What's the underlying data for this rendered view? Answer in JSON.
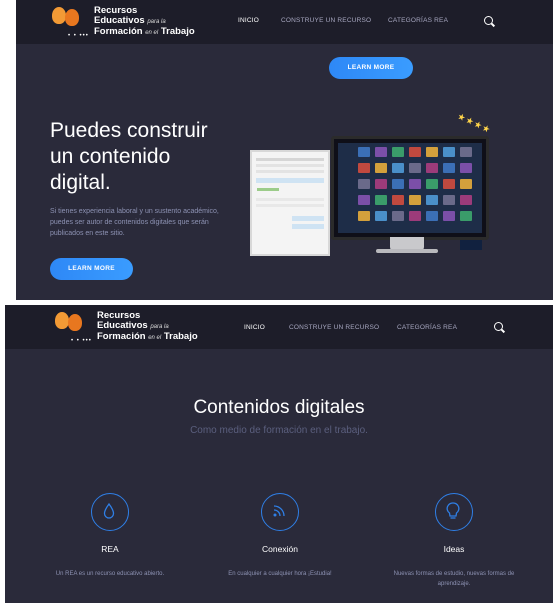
{
  "screens": [
    {
      "logo": {
        "line1": "Recursos",
        "line2": "Educativos",
        "line2_small": "para la",
        "line3": "Formación",
        "line3_small": "en el",
        "line4": "Trabajo",
        "dots": "• • •••"
      },
      "nav": [
        "INICIO",
        "CONSTRUYE UN RECURSO",
        "CATEGORÍAS REA"
      ],
      "top_button": "LEARN MORE",
      "hero": {
        "title_l1": "Puedes construir",
        "title_l2": "un contenido",
        "title_l3": "digital.",
        "text": "Si tienes experiencia laboral y un sustento académico, puedes ser autor de contenidos digitales que serán publicados en este sitio.",
        "button": "LEARN MORE"
      },
      "stars": "★★★★"
    },
    {
      "logo": {
        "line1": "Recursos",
        "line2": "Educativos",
        "line2_small": "para la",
        "line3": "Formación",
        "line3_small": "en el",
        "line4": "Trabajo",
        "dots": "• • •••"
      },
      "nav": [
        "INICIO",
        "CONSTRUYE UN RECURSO",
        "CATEGORÍAS REA"
      ],
      "section": {
        "title": "Contenidos digitales",
        "subtitle": "Como medio de formación en el trabajo."
      },
      "features": [
        {
          "icon": "drop-icon",
          "title": "REA",
          "text": "Un REA es un recurso educativo abierto."
        },
        {
          "icon": "rss-icon",
          "title": "Conexión",
          "text": "En cualquier a cualquier hora ¡Estudia!"
        },
        {
          "icon": "lightbulb-icon",
          "title": "Ideas",
          "text": "Nuevas formas de estudio, nuevas formas de aprendizaje."
        }
      ]
    }
  ],
  "colors": {
    "background": "#2a2a3a",
    "navbar": "#1d1d29",
    "accent": "#2e88f6",
    "logo_orange": "#f08a2a"
  }
}
